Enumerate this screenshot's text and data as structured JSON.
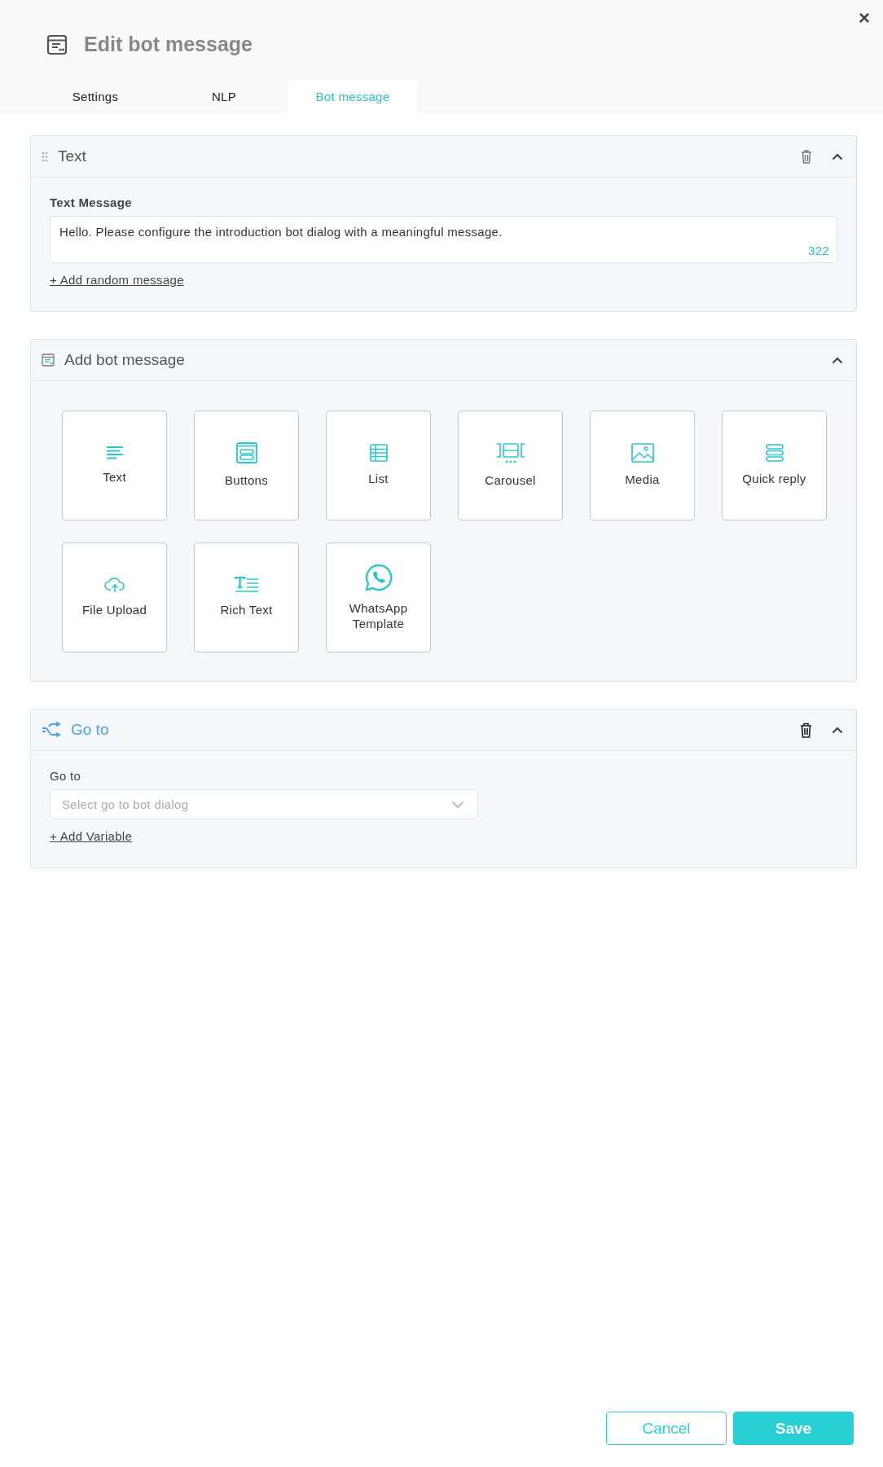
{
  "window": {
    "title": "Edit bot message",
    "close": "×"
  },
  "tabs": [
    {
      "label": "Settings",
      "selected": false
    },
    {
      "label": "NLP",
      "selected": false
    },
    {
      "label": "Bot message",
      "selected": true
    }
  ],
  "text_panel": {
    "title": "Text",
    "expanded": true,
    "field_label": "Text Message",
    "value": "Hello. Please configure the introduction bot dialog with a meaningful message.",
    "counter": "322",
    "link": "+ Add random message"
  },
  "add_panel": {
    "title": "Add bot message",
    "expanded": true,
    "options": [
      {
        "kind": "text",
        "label": "Text"
      },
      {
        "kind": "buttons",
        "label": "Buttons"
      },
      {
        "kind": "list",
        "label": "List"
      },
      {
        "kind": "carousel",
        "label": "Carousel"
      },
      {
        "kind": "media",
        "label": "Media"
      },
      {
        "kind": "quick_reply",
        "label": "Quick reply"
      },
      {
        "kind": "file_upload",
        "label": "File Upload"
      },
      {
        "kind": "rich_text",
        "label": "Rich Text"
      },
      {
        "kind": "whatsapp",
        "label": "WhatsApp Template"
      }
    ]
  },
  "goto_panel": {
    "title": "Go to",
    "expanded": true,
    "field_label": "Go to",
    "placeholder": "Select go to bot dialog",
    "link": "+ Add Variable"
  },
  "buttons": [
    {
      "kind": "secondary",
      "label": "Cancel"
    },
    {
      "kind": "primary",
      "label": "Save"
    }
  ]
}
